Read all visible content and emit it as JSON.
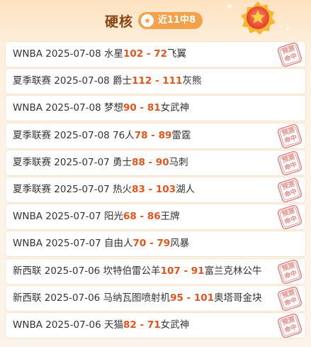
{
  "header": {
    "title": "硬核",
    "badge_label": "近11中8",
    "star_icon": "★"
  },
  "stamp_text": "预测命中",
  "rows": [
    {
      "league": "WNBA",
      "date": "2025-07-08",
      "home": "水星",
      "home_score": "102",
      "sep": " - ",
      "away_score": "72",
      "away": "飞翼",
      "hit": true
    },
    {
      "league": "夏季联赛",
      "date": "2025-07-08",
      "home": "爵士",
      "home_score": "112",
      "sep": " - ",
      "away_score": "111",
      "away": "灰熊",
      "hit": false
    },
    {
      "league": "WNBA",
      "date": "2025-07-08",
      "home": "梦想",
      "home_score": "90",
      "sep": " - ",
      "away_score": "81",
      "away": "女武神",
      "hit": false
    },
    {
      "league": "夏季联赛",
      "date": "2025-07-08",
      "home": "76人",
      "home_score": "78",
      "sep": " - ",
      "away_score": "89",
      "away": "雷霆",
      "hit": true
    },
    {
      "league": "夏季联赛",
      "date": "2025-07-07",
      "home": "勇士",
      "home_score": "88",
      "sep": " - ",
      "away_score": "90",
      "away": "马刺",
      "hit": true
    },
    {
      "league": "夏季联赛",
      "date": "2025-07-07",
      "home": "热火",
      "home_score": "83",
      "sep": " - ",
      "away_score": "103",
      "away": "湖人",
      "hit": true
    },
    {
      "league": "WNBA",
      "date": "2025-07-07",
      "home": "阳光",
      "home_score": "68",
      "sep": " - ",
      "away_score": "86",
      "away": "王牌",
      "hit": true
    },
    {
      "league": "WNBA",
      "date": "2025-07-07",
      "home": "自由人",
      "home_score": "70",
      "sep": " - ",
      "away_score": "79",
      "away": "风暴",
      "hit": false
    },
    {
      "league": "新西联",
      "date": "2025-07-06",
      "home": "坎特伯雷公羊",
      "home_score": "107",
      "sep": " - ",
      "away_score": "91",
      "away": "富兰克林公牛",
      "hit": true
    },
    {
      "league": "新西联",
      "date": "2025-07-06",
      "home": "马纳瓦图喷射机",
      "home_score": "95",
      "sep": " - ",
      "away_score": "101",
      "away": "奥塔哥金块",
      "hit": true
    },
    {
      "league": "WNBA",
      "date": "2025-07-06",
      "home": "天猫",
      "home_score": "82",
      "sep": " - ",
      "away_score": "71",
      "away": "女武神",
      "hit": true
    }
  ],
  "colors": {
    "accent": "#e2541c",
    "title": "#8a4313",
    "badge": "#f3a14b",
    "stamp": "#d9534f"
  }
}
